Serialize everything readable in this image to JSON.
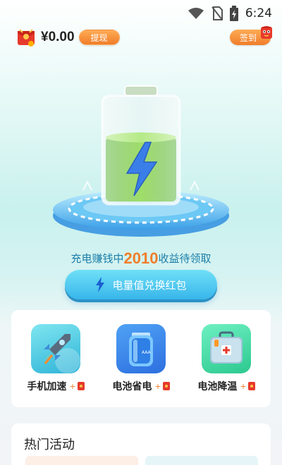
{
  "status_bar": {
    "time": "6:24",
    "icons": [
      "wifi-icon",
      "no-sim-icon",
      "battery-charging-icon"
    ]
  },
  "header": {
    "wallet_icon": "red-envelope-icon",
    "balance": "¥0.00",
    "withdraw_label": "提现",
    "checkin_label": "签到",
    "checkin_badge_icon": "red-envelope-mascot-icon"
  },
  "hero": {
    "battery_icon": "battery-lightning-icon",
    "charge_level": 0.62,
    "promo_prefix": "充电赚钱中",
    "promo_amount": "2010",
    "promo_suffix": "收益待领取",
    "exchange_label": "电量值兑换红包",
    "exchange_icon": "lightning-icon"
  },
  "tools": [
    {
      "name": "手机加速",
      "bonus": "+",
      "icon": "rocket-icon"
    },
    {
      "name": "电池省电",
      "bonus": "+",
      "icon": "battery-cell-icon"
    },
    {
      "name": "电池降温",
      "bonus": "+",
      "icon": "first-aid-kit-icon"
    }
  ],
  "hot": {
    "title": "热门活动"
  },
  "colors": {
    "accent_orange": "#f07d2a",
    "accent_blue": "#38b6ea",
    "promo_text": "#1a7ea8",
    "battery_green": "#6cc23a"
  }
}
